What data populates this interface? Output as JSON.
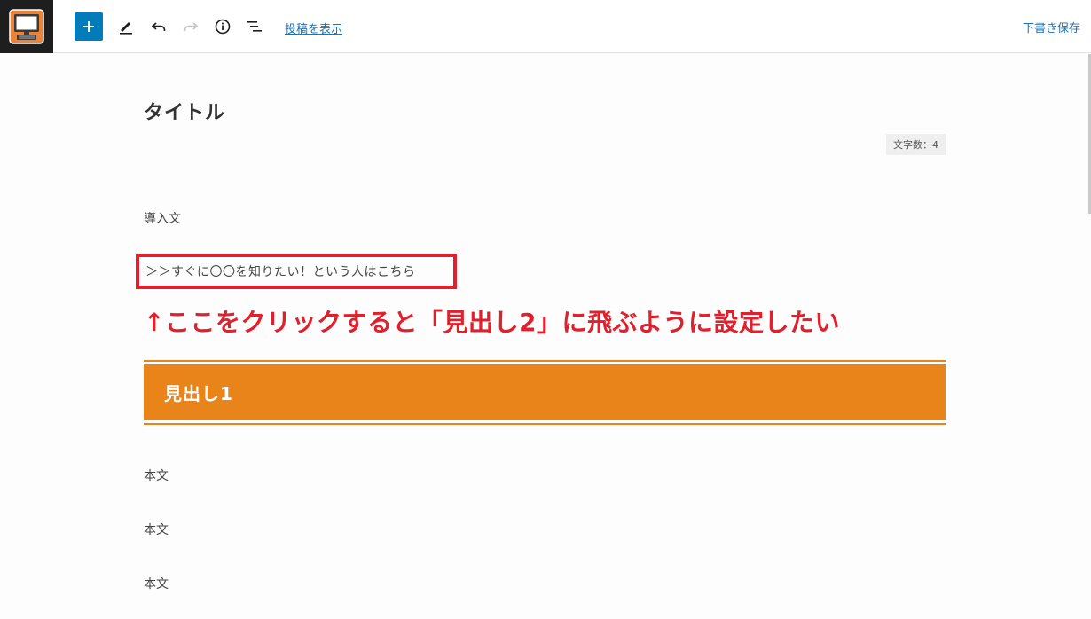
{
  "toolbar": {
    "site_icon": "desktop-computer-icon",
    "add_block": "plus-icon",
    "tools": "pencil-icon",
    "undo": "undo-icon",
    "redo": "redo-icon",
    "details": "info-icon",
    "list_view": "list-view-icon",
    "preview_label": "投稿を表示",
    "save_draft_label": "下書き保存",
    "accent_color": "#007cba"
  },
  "editor": {
    "title": "タイトル",
    "char_count": "文字数：4",
    "intro": "導入文",
    "link_paragraph": "＞＞すぐに〇〇を知りたい！という人はこちら",
    "annotation": "↑ここをクリックすると「見出し2」に飛ぶように設定したい",
    "heading1": "見出し1",
    "body": [
      "本文",
      "本文",
      "本文"
    ],
    "heading_color": "#e9841a",
    "annotation_color": "#e0212d"
  }
}
